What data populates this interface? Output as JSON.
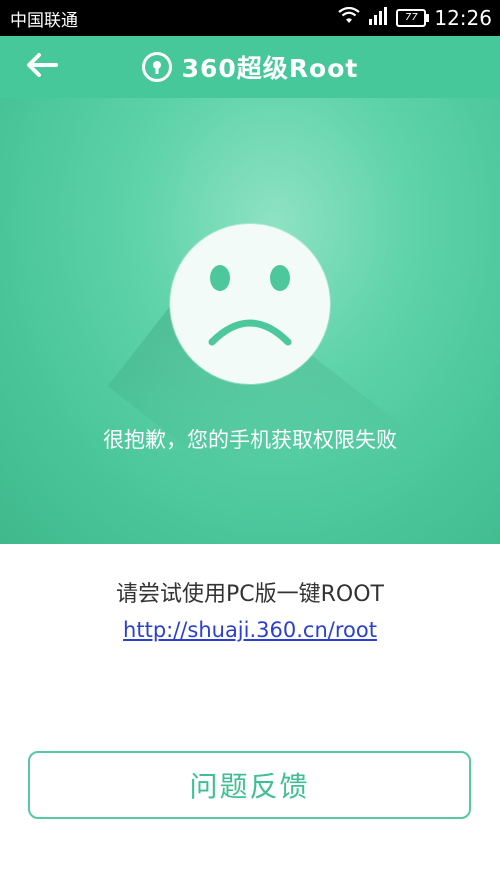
{
  "status_bar": {
    "carrier": "中国联通",
    "battery": "77",
    "time": "12:26"
  },
  "header": {
    "title": "360超级Root"
  },
  "hero": {
    "message": "很抱歉，您的手机获取权限失败"
  },
  "content": {
    "suggestion": "请尝试使用PC版一键ROOT",
    "link": "http://shuaji.360.cn/root"
  },
  "feedback_button": {
    "label": "问题反馈"
  },
  "colors": {
    "header": "#47c89a",
    "accent": "#3fbf92",
    "link": "#2b3fd1"
  },
  "icons": [
    "wifi-icon",
    "signal-icon",
    "battery-icon",
    "back-arrow-icon",
    "lock-logo-icon",
    "sad-face-icon"
  ]
}
